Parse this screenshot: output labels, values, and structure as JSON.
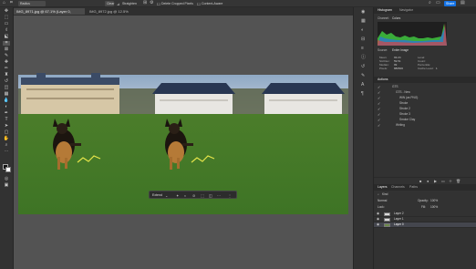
{
  "options": {
    "preset_label": "Radius",
    "mode_value": "Pixels",
    "clear_label": "Clear",
    "straighten_label": "Straighten",
    "delete_cropped_label": "Delete Cropped Pixels",
    "content_aware_label": "Content-Aware",
    "share_label": "Share"
  },
  "tabs": [
    {
      "label": "IMG_8971.jpg @ 67.1% (Layer 0, RGB/8) *",
      "active": true
    },
    {
      "label": "IMG_8972.jpg @ 12.5% (RGB/8*)",
      "active": false
    }
  ],
  "histogram": {
    "tabs": [
      "Histogram",
      "Navigator"
    ],
    "channel_label": "Channel:",
    "channel_value": "Colors",
    "source_label": "Source:",
    "source_value": "Entire Image",
    "stats": [
      {
        "label": "Mean:",
        "value": "93.24"
      },
      {
        "label": "Std Dev:",
        "value": "59.51"
      },
      {
        "label": "Median:",
        "value": "99"
      },
      {
        "label": "Pixels:",
        "value": "880500"
      },
      {
        "label": "Level:",
        "value": ""
      },
      {
        "label": "Count:",
        "value": ""
      },
      {
        "label": "Percentile:",
        "value": ""
      },
      {
        "label": "Cache Level:",
        "value": "1"
      }
    ]
  },
  "actions": {
    "title": "Actions",
    "items": [
      {
        "label": "GTS",
        "level": 0
      },
      {
        "label": "GTS - New",
        "level": 1
      },
      {
        "label": "WIN (as PNG)",
        "level": 2
      },
      {
        "label": "Stroke",
        "level": 2
      },
      {
        "label": "Stroke 2",
        "level": 2
      },
      {
        "label": "Stroke 3",
        "level": 2
      },
      {
        "label": "Smoke Clay",
        "level": 2
      },
      {
        "label": "Writing",
        "level": 1
      }
    ]
  },
  "layers": {
    "tabs": [
      "Layers",
      "Channels",
      "Paths"
    ],
    "kind_label": "Kind",
    "blend_mode": "Normal",
    "opacity_label": "Opacity:",
    "opacity_value": "100%",
    "lock_label": "Lock:",
    "fill_label": "Fill:",
    "fill_value": "100%",
    "items": [
      {
        "name": "Layer 2",
        "selected": false
      },
      {
        "name": "Layer 1",
        "selected": false
      },
      {
        "name": "Layer 0",
        "selected": true
      }
    ]
  },
  "contextbar": {
    "select_label": "Extend"
  }
}
